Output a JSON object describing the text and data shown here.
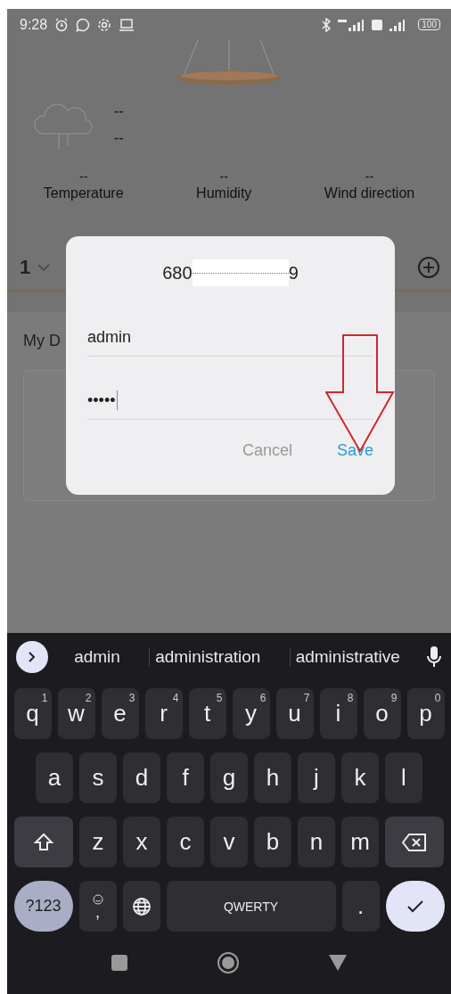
{
  "status_bar": {
    "time": "9:28",
    "battery": "100"
  },
  "weather": {
    "line_1": "--",
    "line_2": "--"
  },
  "stats": [
    {
      "value": "--",
      "label": "Temperature"
    },
    {
      "value": "--",
      "label": "Humidity"
    },
    {
      "value": "--",
      "label": "Wind direction"
    }
  ],
  "room": {
    "number": "1"
  },
  "section": {
    "title": "My D"
  },
  "dialog": {
    "title_start": "680",
    "title_end": "9",
    "username": "admin",
    "password": "•••••",
    "buttons": [
      {
        "label": "Cancel",
        "kind": "secondary"
      },
      {
        "label": "Save",
        "kind": "primary"
      }
    ]
  },
  "keyboard": {
    "suggestions": [
      "admin",
      "administration",
      "administrative"
    ],
    "rows": [
      [
        {
          "key": "q",
          "hint": "1"
        },
        {
          "key": "w",
          "hint": "2"
        },
        {
          "key": "e",
          "hint": "3"
        },
        {
          "key": "r",
          "hint": "4"
        },
        {
          "key": "t",
          "hint": "5"
        },
        {
          "key": "y",
          "hint": "6"
        },
        {
          "key": "u",
          "hint": "7"
        },
        {
          "key": "i",
          "hint": "8"
        },
        {
          "key": "o",
          "hint": "9"
        },
        {
          "key": "p",
          "hint": "0"
        }
      ],
      [
        {
          "key": "a"
        },
        {
          "key": "s"
        },
        {
          "key": "d"
        },
        {
          "key": "f"
        },
        {
          "key": "g"
        },
        {
          "key": "h"
        },
        {
          "key": "j"
        },
        {
          "key": "k"
        },
        {
          "key": "l"
        }
      ],
      [
        {
          "kind": "shift"
        },
        {
          "key": "z"
        },
        {
          "key": "x"
        },
        {
          "key": "c"
        },
        {
          "key": "v"
        },
        {
          "key": "b"
        },
        {
          "key": "n"
        },
        {
          "key": "m"
        },
        {
          "kind": "backspace"
        }
      ]
    ],
    "bottom_row": [
      {
        "kind": "symbols",
        "key": "?123"
      },
      {
        "kind": "emoji",
        "key": ","
      },
      {
        "kind": "globe"
      },
      {
        "kind": "space",
        "key": "QWERTY"
      },
      {
        "key": "."
      },
      {
        "kind": "enter"
      }
    ]
  }
}
